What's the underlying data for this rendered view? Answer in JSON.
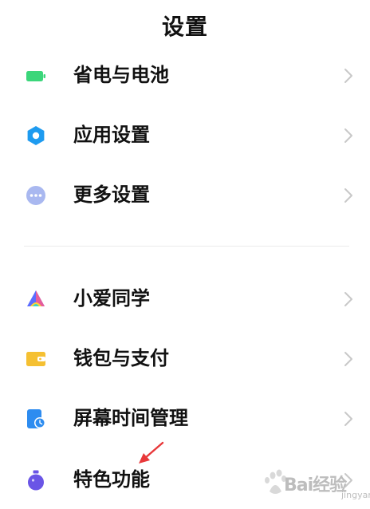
{
  "header": {
    "title": "设置"
  },
  "colors": {
    "battery": "#3bd67a",
    "app_settings": "#1e9bf0",
    "more_settings": "#a9b8f0",
    "xiaoai": "#5b6cff",
    "wallet": "#f5c032",
    "screen_time": "#2d8cf0",
    "special": "#6a55e6",
    "chevron": "#c8c8c8",
    "annotation_arrow": "#e8383a"
  },
  "groups": [
    {
      "items": [
        {
          "label": "省电与电池",
          "icon": "battery-icon"
        },
        {
          "label": "应用设置",
          "icon": "gear-icon"
        },
        {
          "label": "更多设置",
          "icon": "more-dots-icon"
        }
      ]
    },
    {
      "items": [
        {
          "label": "小爱同学",
          "icon": "xiaoai-icon"
        },
        {
          "label": "钱包与支付",
          "icon": "wallet-icon"
        },
        {
          "label": "屏幕时间管理",
          "icon": "screen-time-icon"
        },
        {
          "label": "特色功能",
          "icon": "flask-icon"
        }
      ]
    }
  ],
  "watermark": {
    "text": "Bai经验",
    "sub": "jingyan"
  }
}
